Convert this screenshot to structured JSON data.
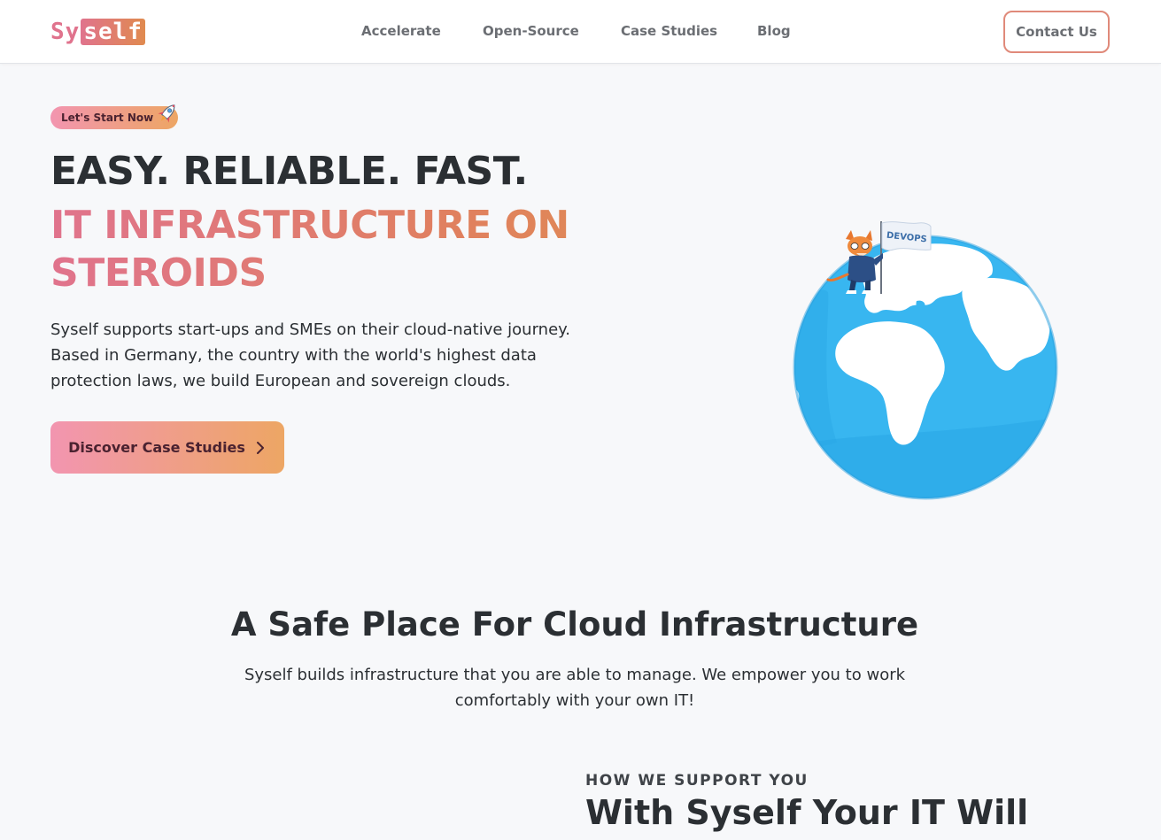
{
  "brand": {
    "logo_part1": "Sy",
    "logo_part2": "self"
  },
  "nav": {
    "items": [
      {
        "label": "Accelerate"
      },
      {
        "label": "Open-Source"
      },
      {
        "label": "Case Studies"
      },
      {
        "label": "Blog"
      }
    ],
    "contact_label": "Contact Us"
  },
  "hero": {
    "badge_label": "Let's Start Now",
    "badge_icon": "rocket-icon",
    "headline_line1": "EASY. RELIABLE. FAST.",
    "headline_line2": "IT INFRASTRUCTURE ON STEROIDS",
    "description": "Syself supports start-ups and SMEs on their cloud-native journey. Based in Germany, the country with the world's highest data protection laws, we build European and sovereign clouds.",
    "cta_label": "Discover Case Studies",
    "cta_icon": "chevron-right-icon",
    "illustration_flag_text": "DEVOPS"
  },
  "safe_section": {
    "title": "A Safe Place For Cloud Infrastructure",
    "description": "Syself builds infrastructure that you are able to manage. We empower you to work comfortably with your own IT!"
  },
  "support_section": {
    "eyebrow": "HOW WE SUPPORT YOU",
    "title": "With Syself Your IT Will"
  },
  "colors": {
    "accent_pink": "#e0738d",
    "accent_orange": "#e08a4f",
    "text_dark": "#2b2f33",
    "globe_blue": "#38b6f0"
  }
}
